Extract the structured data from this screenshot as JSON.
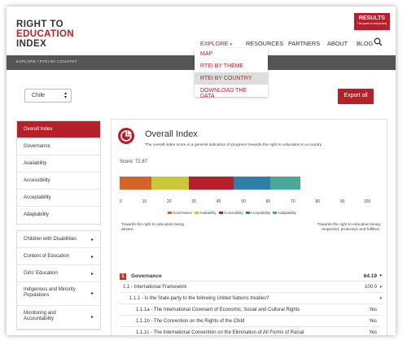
{
  "logo": {
    "line1": "RIGHT TO",
    "line2": "EDUCATION",
    "line3": "INDEX"
  },
  "badge": {
    "title": "RESULTS",
    "subtitle": "The power to end poverty"
  },
  "nav": {
    "items": [
      "EXPLORE",
      "RESOURCES",
      "PARTNERS",
      "ABOUT",
      "BLOG"
    ],
    "explore_caret": "▾"
  },
  "breadcrumb": "EXPLORE / RTEI BY COUNTRY",
  "explore_menu": [
    "MAP",
    "RTEI BY THEME",
    "RTEI BY COUNTRY",
    "DOWNLOAD THE DATA"
  ],
  "country_select": {
    "value": "Chile"
  },
  "export_label": "Export all",
  "sidebar_primary": [
    "Overall Index",
    "Governance",
    "Availability",
    "Accessibility",
    "Acceptability",
    "Adaptability"
  ],
  "sidebar_secondary": [
    "Children with Disabilities",
    "Content of Education",
    "Girls' Education",
    "Indigenous and Minority Populations",
    "Monitoring and Accountability"
  ],
  "main": {
    "title": "Overall Index",
    "description": "The overall index score is a general indication of progress towards the right to education in a country.",
    "score_label": "Score: 72.87",
    "left_note": "Towards the right to education being absent.",
    "right_note": "Towards the right to education being respected, protected, and fulfilled."
  },
  "chart_data": {
    "type": "bar",
    "orientation": "horizontal-stacked",
    "xlim": [
      0,
      100
    ],
    "ticks": [
      "0",
      "10",
      "20",
      "30",
      "40",
      "50",
      "60",
      "70",
      "80",
      "90",
      "100"
    ],
    "series": [
      {
        "name": "Governance",
        "value": 12.9,
        "color": "#d4652a"
      },
      {
        "name": "Availability",
        "value": 15.0,
        "color": "#c8c93a"
      },
      {
        "name": "Accessibility",
        "value": 18.3,
        "color": "#b5212b"
      },
      {
        "name": "Acceptability",
        "value": 14.5,
        "color": "#2f7fa8"
      },
      {
        "name": "Adaptability",
        "value": 12.2,
        "color": "#4aa89a"
      }
    ]
  },
  "table": {
    "rows": [
      {
        "num": "1",
        "label": "Governance",
        "value": "64.19",
        "caret": "▾"
      },
      {
        "label": "1.1 - International Framework",
        "value": "100.0",
        "caret": "▾"
      },
      {
        "label": "1.1.1 - Is the State party to the following United Nations treaties?",
        "value": "",
        "caret": "▾"
      },
      {
        "label": "1.1.1a - The International Covenant of Economic, Social and Cultural Rights",
        "value": "Yes"
      },
      {
        "label": "1.1.1b - The Convention on the Rights of the Child",
        "value": "Yes"
      },
      {
        "label": "1.1.1c - The International Convention on the Elimination of All Forms of Racial",
        "value": "Yes"
      }
    ]
  }
}
